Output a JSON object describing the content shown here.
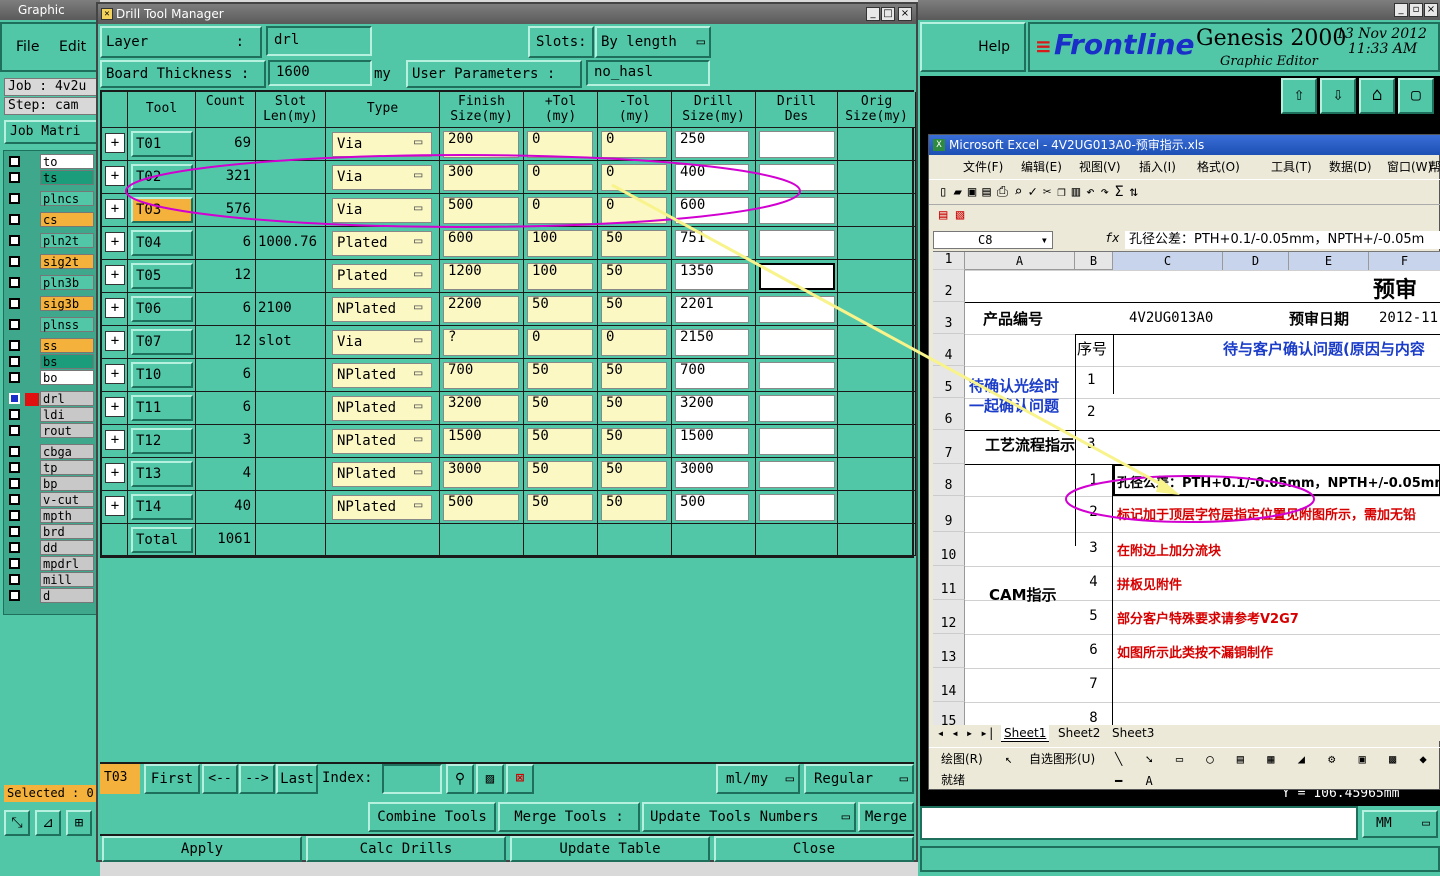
{
  "graphic_editor": {
    "title": "Graphic Editor",
    "menu": [
      "File",
      "Edit"
    ],
    "help": "Help",
    "job": "Job : 4v2u",
    "step": "Step: cam",
    "job_matrix": "Job Matri",
    "selected": "Selected : 0",
    "units": "MM",
    "coord": "Y = 106.45965mm"
  },
  "layers": [
    {
      "name": "to",
      "color": "#ffffff",
      "check": false
    },
    {
      "name": "ts",
      "color": "#1b9c7b",
      "check": false
    },
    {
      "name": "plncs",
      "color": "#52c7a8",
      "check": false
    },
    {
      "name": "cs",
      "color": "#f4b23c",
      "check": false
    },
    {
      "name": "pln2t",
      "color": "#52c7a8",
      "check": false
    },
    {
      "name": "sig2t",
      "color": "#f4b23c",
      "check": false
    },
    {
      "name": "pln3b",
      "color": "#52c7a8",
      "check": false
    },
    {
      "name": "sig3b",
      "color": "#f4b23c",
      "check": false
    },
    {
      "name": "plnss",
      "color": "#52c7a8",
      "check": false
    },
    {
      "name": "ss",
      "color": "#f4b23c",
      "check": false
    },
    {
      "name": "bs",
      "color": "#1b9c7b",
      "check": false
    },
    {
      "name": "bo",
      "color": "#ffffff",
      "check": false
    },
    {
      "name": "drl",
      "color": "#c8c8c8",
      "check": true
    },
    {
      "name": "ldi",
      "color": "#c8c8c8",
      "check": false
    },
    {
      "name": "rout",
      "color": "#c8c8c8",
      "check": false
    },
    {
      "name": "cbga",
      "color": "#c8c8c8",
      "check": false
    },
    {
      "name": "tp",
      "color": "#c8c8c8",
      "check": false
    },
    {
      "name": "bp",
      "color": "#c8c8c8",
      "check": false
    },
    {
      "name": "v-cut",
      "color": "#c8c8c8",
      "check": false
    },
    {
      "name": "mpth",
      "color": "#c8c8c8",
      "check": false
    },
    {
      "name": "brd",
      "color": "#c8c8c8",
      "check": false
    },
    {
      "name": "dd",
      "color": "#c8c8c8",
      "check": false
    },
    {
      "name": "mpdrl",
      "color": "#c8c8c8",
      "check": false
    },
    {
      "name": "mill",
      "color": "#c8c8c8",
      "check": false
    },
    {
      "name": "d",
      "color": "#c8c8c8",
      "check": false
    }
  ],
  "frontline": {
    "logo": "Frontline",
    "product": "Genesis 2000",
    "subtitle": "Graphic Editor",
    "date": "13 Nov 2012",
    "time": "11:33 AM"
  },
  "dtm": {
    "title": "Drill Tool Manager",
    "layer_label": "Layer",
    "layer_colon": ":",
    "layer_value": "drl",
    "slots_label": "Slots:",
    "slots_value": "By length",
    "board_label": "Board Thickness :",
    "board_value": "1600",
    "board_unit": "my",
    "user_params_label": "User Parameters :",
    "user_params_value": "no_hasl",
    "headers": [
      "Tool",
      "Count",
      "Slot\nLen(my)",
      "Type",
      "Finish\nSize(my)",
      "+Tol\n(my)",
      "-Tol\n(my)",
      "Drill\nSize(my)",
      "Drill\nDes",
      "Orig\nSize(my)"
    ],
    "rows": [
      {
        "tool": "T01",
        "count": "69",
        "slot": "",
        "type": "Via",
        "finish": "200",
        "ptol": "0",
        "mtol": "0",
        "drill": "250",
        "des": "",
        "orig": ""
      },
      {
        "tool": "T02",
        "count": "321",
        "slot": "",
        "type": "Via",
        "finish": "300",
        "ptol": "0",
        "mtol": "0",
        "drill": "400",
        "des": "",
        "orig": ""
      },
      {
        "tool": "T03",
        "count": "576",
        "slot": "",
        "type": "Via",
        "finish": "500",
        "ptol": "0",
        "mtol": "0",
        "drill": "600",
        "des": "",
        "orig": ""
      },
      {
        "tool": "T04",
        "count": "6",
        "slot": "1000.76",
        "type": "Plated",
        "finish": "600",
        "ptol": "100",
        "mtol": "50",
        "drill": "751",
        "des": "",
        "orig": ""
      },
      {
        "tool": "T05",
        "count": "12",
        "slot": "",
        "type": "Plated",
        "finish": "1200",
        "ptol": "100",
        "mtol": "50",
        "drill": "1350",
        "des": "",
        "orig": ""
      },
      {
        "tool": "T06",
        "count": "6",
        "slot": "2100",
        "type": "NPlated",
        "finish": "2200",
        "ptol": "50",
        "mtol": "50",
        "drill": "2201",
        "des": "",
        "orig": ""
      },
      {
        "tool": "T07",
        "count": "12",
        "slot": "slot",
        "type": "Via",
        "finish": "?",
        "ptol": "0",
        "mtol": "0",
        "drill": "2150",
        "des": "",
        "orig": ""
      },
      {
        "tool": "T10",
        "count": "6",
        "slot": "",
        "type": "NPlated",
        "finish": "700",
        "ptol": "50",
        "mtol": "50",
        "drill": "700",
        "des": "",
        "orig": ""
      },
      {
        "tool": "T11",
        "count": "6",
        "slot": "",
        "type": "NPlated",
        "finish": "3200",
        "ptol": "50",
        "mtol": "50",
        "drill": "3200",
        "des": "",
        "orig": ""
      },
      {
        "tool": "T12",
        "count": "3",
        "slot": "",
        "type": "NPlated",
        "finish": "1500",
        "ptol": "50",
        "mtol": "50",
        "drill": "1500",
        "des": "",
        "orig": ""
      },
      {
        "tool": "T13",
        "count": "4",
        "slot": "",
        "type": "NPlated",
        "finish": "3000",
        "ptol": "50",
        "mtol": "50",
        "drill": "3000",
        "des": "",
        "orig": ""
      },
      {
        "tool": "T14",
        "count": "40",
        "slot": "",
        "type": "NPlated",
        "finish": "500",
        "ptol": "50",
        "mtol": "50",
        "drill": "500",
        "des": "",
        "orig": ""
      }
    ],
    "total_label": "Total",
    "total_count": "1061",
    "current_tool": "T03",
    "nav": {
      "first": "First",
      "prev": "<--",
      "next": "-->",
      "last": "Last",
      "index": "Index:"
    },
    "units": "ml/my",
    "mode": "Regular",
    "combine": "Combine Tools",
    "merge_tools": "Merge Tools :",
    "update_numbers": "Update Tools Numbers",
    "merge": "Merge",
    "apply": "Apply",
    "calc": "Calc Drills",
    "update_table": "Update Table",
    "close": "Close"
  },
  "excel": {
    "title": "Microsoft Excel - 4V2UG013A0-预审指示.xls",
    "menu": [
      "文件(F)",
      "编辑(E)",
      "视图(V)",
      "插入(I)",
      "格式(O)",
      "工具(T)",
      "数据(D)",
      "窗口(W)",
      "帮"
    ],
    "cell_ref": "C8",
    "formula": "孔径公差：PTH+0.1/-0.05mm，NPTH+/-0.05m",
    "cols": [
      "A",
      "B",
      "C",
      "D",
      "E",
      "F"
    ],
    "r1": "预审",
    "r2_a": "产品编号",
    "r2_c": "4V2UG013A0",
    "r2_e": "预审日期",
    "r2_f": "2012-11",
    "r3_b": "序号",
    "r3_c": "待与客户确认问题(原因与内容",
    "confirm_note": "待确认光绘时一起确认问题",
    "seq": [
      "1",
      "2",
      "3"
    ],
    "process": "工艺流程指示",
    "cam": "CAM指示",
    "items": [
      {
        "n": "1",
        "t": "孔径公差：PTH+0.1/-0.05mm，NPTH+/-0.05mm",
        "red": false
      },
      {
        "n": "2",
        "t": "标记加于顶层字符层指定位置见附图所示，需加无铅",
        "red": true
      },
      {
        "n": "3",
        "t": "在附边上加分流块",
        "red": true
      },
      {
        "n": "4",
        "t": "拼板见附件",
        "red": true
      },
      {
        "n": "5",
        "t": "部分客户特殊要求请参考V2G7",
        "red": true
      },
      {
        "n": "6",
        "t": "如图所示此类按不漏铜制作",
        "red": true
      },
      {
        "n": "7",
        "t": "",
        "red": false
      },
      {
        "n": "8",
        "t": "",
        "red": false
      }
    ],
    "row_nums": [
      "1",
      "2",
      "3",
      "4",
      "5",
      "6",
      "7",
      "8",
      "9",
      "10",
      "11",
      "12",
      "13",
      "14",
      "15"
    ],
    "sheets": [
      "Sheet1",
      "Sheet2",
      "Sheet3"
    ],
    "draw_toolbar": "绘图(R)",
    "autoshape": "自选图形(U)",
    "status": "就绪"
  }
}
